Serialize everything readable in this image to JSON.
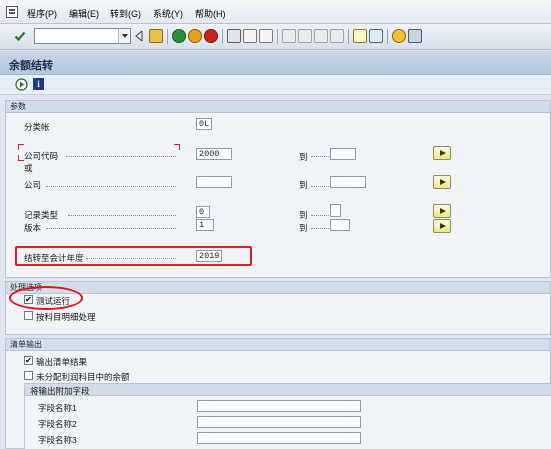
{
  "menu": {
    "items": [
      "程序(P)",
      "编辑(E)",
      "转到(G)",
      "系统(Y)",
      "帮助(H)"
    ]
  },
  "toolbar": {
    "command_value": "",
    "icons": [
      "enter-icon",
      "save-icon",
      "back-icon",
      "exit-icon",
      "cancel-icon",
      "print-icon",
      "find-icon",
      "find-next-icon",
      "first-page-icon",
      "prev-page-icon",
      "next-page-icon",
      "last-page-icon",
      "new-session-icon",
      "shortcut-icon",
      "help-icon",
      "layout-icon"
    ]
  },
  "page": {
    "title": "余额结转"
  },
  "params": {
    "group_title": "参数",
    "ledger_label": "分类帐",
    "ledger_value": "0L",
    "company_code_label": "公司代码",
    "company_code_value": "2000",
    "or_label": "或",
    "company_label": "公司",
    "company_value": "",
    "record_type_label": "记录类型",
    "record_type_value": "0",
    "version_label": "版本",
    "version_value": "1",
    "to_label": "到",
    "carry_year_label": "结转至会计年度",
    "carry_year_value": "2019"
  },
  "processing": {
    "group_title": "处理选项",
    "test_run_label": "测试运行",
    "test_run_checked": true,
    "detail_label": "按科目明细处理",
    "detail_checked": false
  },
  "output": {
    "group_title": "清单输出",
    "output_results_label": "输出清单结果",
    "output_results_checked": true,
    "unassigned_label": "未分配利润科目中的余额",
    "unassigned_checked": false,
    "subgroup_title": "将输出附加字段",
    "field1_label": "字段名称1",
    "field2_label": "字段名称2",
    "field3_label": "字段名称3",
    "field1_value": "",
    "field2_value": "",
    "field3_value": ""
  },
  "colors": {
    "highlight_red": "#d9221b",
    "title_bar": "#c8d6e6",
    "group_bg": "#f0f3f7"
  }
}
